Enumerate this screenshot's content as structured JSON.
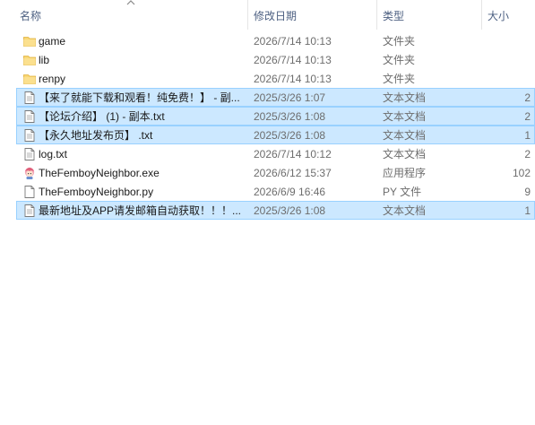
{
  "columns": {
    "name": "名称",
    "date": "修改日期",
    "type": "类型",
    "size": "大小"
  },
  "files": [
    {
      "name": "game",
      "date": "2026/7/14 10:13",
      "type": "文件夹",
      "size": "",
      "icon": "folder-icon",
      "selected": false
    },
    {
      "name": "lib",
      "date": "2026/7/14 10:13",
      "type": "文件夹",
      "size": "",
      "icon": "folder-icon",
      "selected": false
    },
    {
      "name": "renpy",
      "date": "2026/7/14 10:13",
      "type": "文件夹",
      "size": "",
      "icon": "folder-icon",
      "selected": false
    },
    {
      "name": "【来了就能下载和观看！纯免费！】 - 副...",
      "date": "2025/3/26 1:07",
      "type": "文本文档",
      "size": "2",
      "icon": "text-file-icon",
      "selected": true
    },
    {
      "name": "【论坛介绍】 (1) - 副本.txt",
      "date": "2025/3/26 1:08",
      "type": "文本文档",
      "size": "2",
      "icon": "text-file-icon",
      "selected": true
    },
    {
      "name": "【永久地址发布页】 .txt",
      "date": "2025/3/26 1:08",
      "type": "文本文档",
      "size": "1",
      "icon": "text-file-icon",
      "selected": true
    },
    {
      "name": "log.txt",
      "date": "2026/7/14 10:12",
      "type": "文本文档",
      "size": "2",
      "icon": "text-file-icon",
      "selected": false
    },
    {
      "name": "TheFemboyNeighbor.exe",
      "date": "2026/6/12 15:37",
      "type": "应用程序",
      "size": "102",
      "icon": "app-icon",
      "selected": false
    },
    {
      "name": "TheFemboyNeighbor.py",
      "date": "2026/6/9 16:46",
      "type": "PY 文件",
      "size": "9",
      "icon": "blank-file-icon",
      "selected": false
    },
    {
      "name": "最新地址及APP请发邮箱自动获取！！！...",
      "date": "2025/3/26 1:08",
      "type": "文本文档",
      "size": "1",
      "icon": "text-file-icon",
      "selected": true
    }
  ],
  "colors": {
    "selection_bg": "#cce8ff",
    "selection_border": "#99d1ff",
    "header_text": "#4d6082",
    "folder": "#f8d775"
  }
}
